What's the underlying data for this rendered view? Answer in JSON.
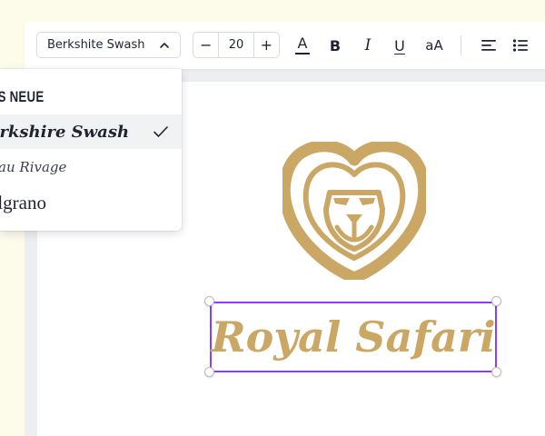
{
  "toolbar": {
    "font_name": "Berkshite Swash",
    "font_size": "20",
    "decrease_label": "−",
    "increase_label": "+",
    "text_color_label": "A",
    "bold_label": "B",
    "italic_label": "I",
    "underline_label": "U",
    "case_label": "aA"
  },
  "font_dropdown": {
    "items": [
      {
        "label": "BAS NEUE",
        "selected": false
      },
      {
        "label": "erkshire Swash",
        "selected": true
      },
      {
        "label": "reau Rivage",
        "selected": false
      },
      {
        "label": "elgrano",
        "selected": false
      }
    ]
  },
  "canvas": {
    "logo_icon": "lion-head-icon",
    "title_text": "Royal Safari"
  },
  "colors": {
    "accent_gold": "#caa764",
    "selection": "#8b3dff",
    "background": "#fdfbea"
  }
}
